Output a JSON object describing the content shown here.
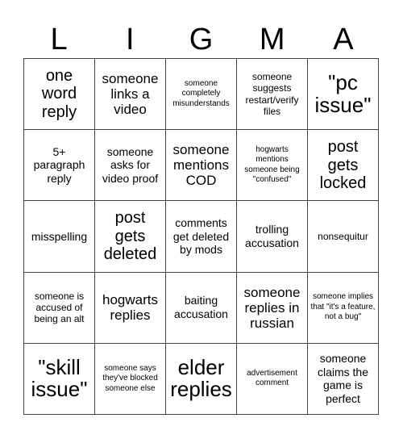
{
  "title_letters": [
    "L",
    "I",
    "G",
    "M",
    "A"
  ],
  "cells": [
    [
      {
        "text": "one word reply",
        "size": "l"
      },
      {
        "text": "someone links a video",
        "size": "m"
      },
      {
        "text": "someone completely misunderstands",
        "size": "xxs"
      },
      {
        "text": "someone suggests restart/verify files",
        "size": "xs"
      },
      {
        "text": "\"pc issue\"",
        "size": "xl"
      }
    ],
    [
      {
        "text": "5+ paragraph reply",
        "size": "sm"
      },
      {
        "text": "someone asks for video proof",
        "size": "sm"
      },
      {
        "text": "someone mentions COD",
        "size": "m"
      },
      {
        "text": "hogwarts mentions someone being \"confused\"",
        "size": "xxs"
      },
      {
        "text": "post gets locked",
        "size": "l"
      }
    ],
    [
      {
        "text": "misspelling",
        "size": "sm"
      },
      {
        "text": "post gets deleted",
        "size": "l"
      },
      {
        "text": "comments get deleted by mods",
        "size": "sm"
      },
      {
        "text": "trolling accusation",
        "size": "sm"
      },
      {
        "text": "nonsequitur",
        "size": "xs"
      }
    ],
    [
      {
        "text": "someone is accused of being an alt",
        "size": "xs"
      },
      {
        "text": "hogwarts replies",
        "size": "m"
      },
      {
        "text": "baiting accusation",
        "size": "sm"
      },
      {
        "text": "someone replies in russian",
        "size": "m"
      },
      {
        "text": "someone implies that \"it's a feature, not a bug\"",
        "size": "xxs"
      }
    ],
    [
      {
        "text": "\"skill issue\"",
        "size": "xl"
      },
      {
        "text": "someone says they've blocked someone else",
        "size": "xxs"
      },
      {
        "text": "elder replies",
        "size": "xl"
      },
      {
        "text": "advertisement comment",
        "size": "xxs"
      },
      {
        "text": "someone claims the game is perfect",
        "size": "sm"
      }
    ]
  ]
}
